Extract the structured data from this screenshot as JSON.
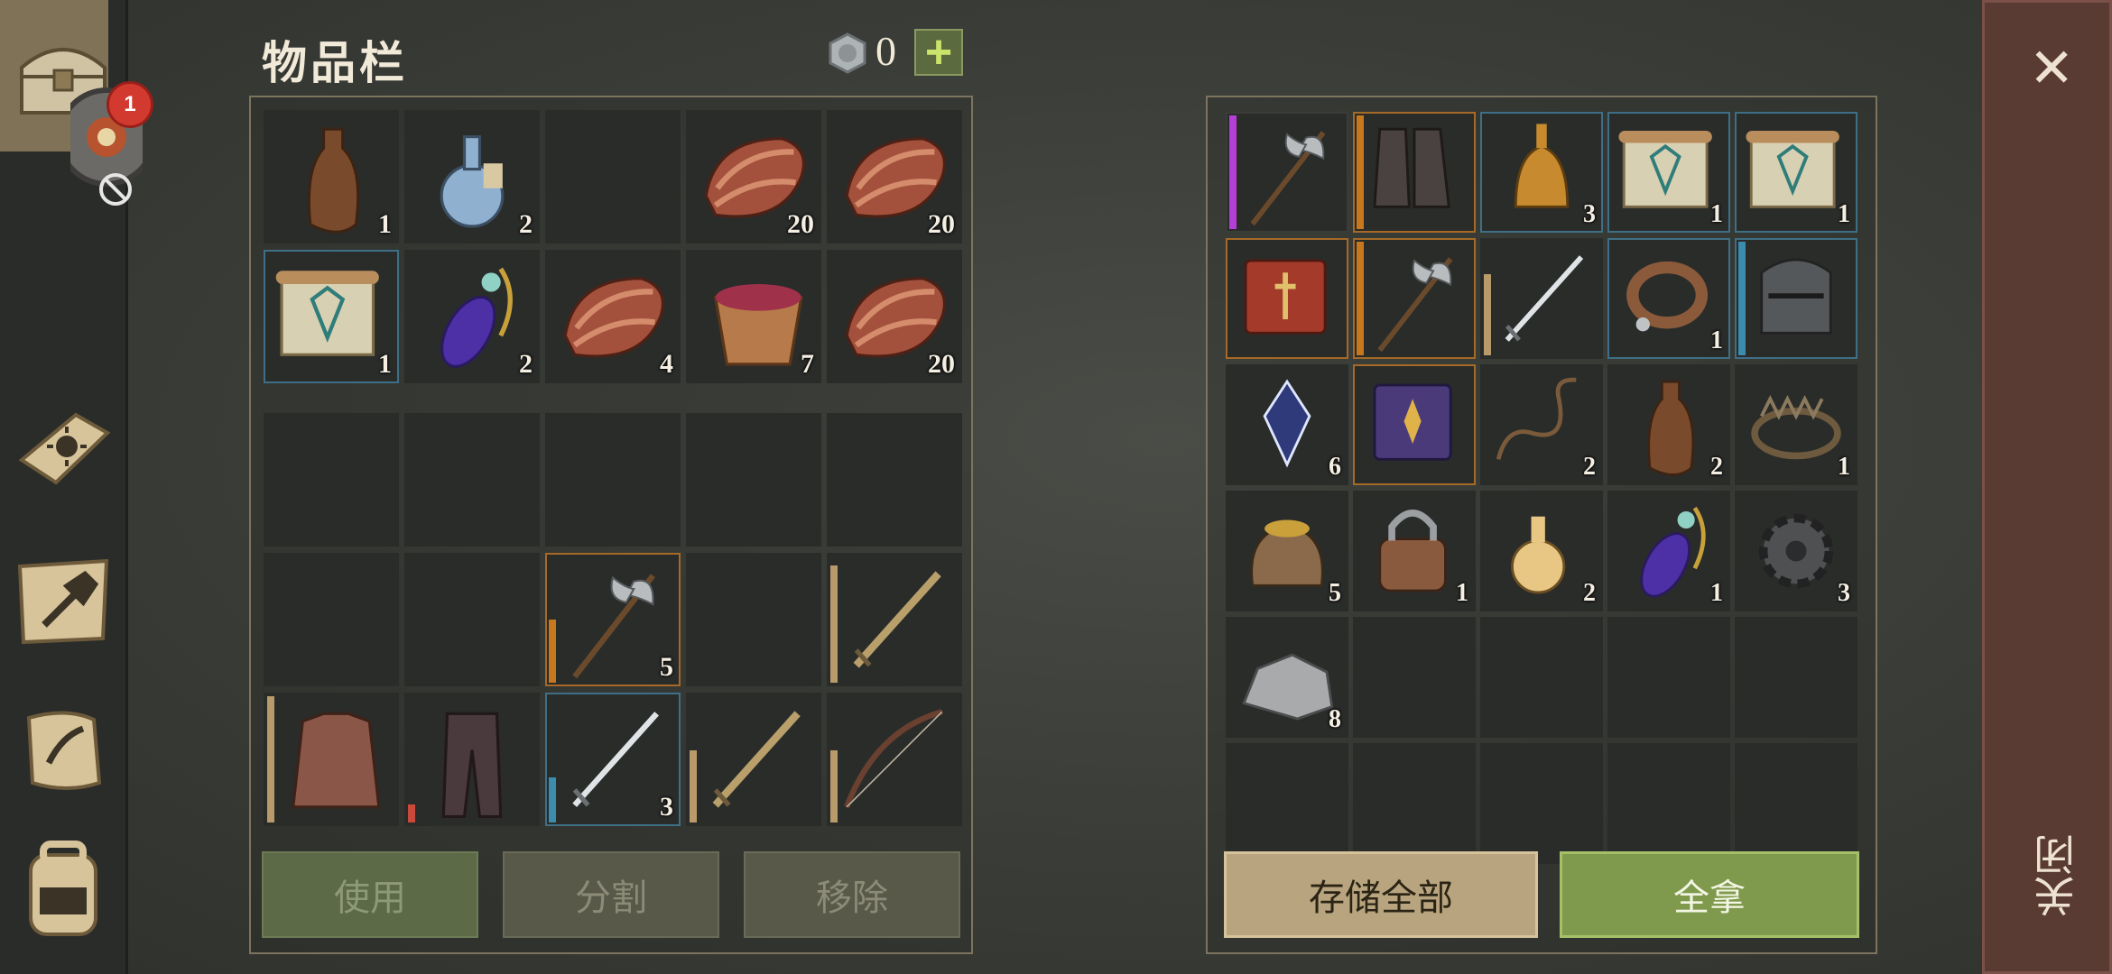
{
  "inventory": {
    "title": "物品栏",
    "coin_count": "0",
    "plus_label": "+",
    "top_counts": [
      "1",
      "2",
      "",
      "20",
      "20",
      "1",
      "2",
      "4",
      "7",
      "20"
    ],
    "bottom_counts": [
      "",
      "",
      "",
      "",
      "",
      "",
      "",
      "5",
      "",
      ""
    ],
    "bottom_row3": [
      "",
      "",
      "3",
      "",
      ""
    ],
    "buttons": {
      "use": "使用",
      "split": "分割",
      "remove": "移除"
    }
  },
  "chest": {
    "counts": [
      "",
      "",
      "3",
      "1",
      "1",
      "",
      "",
      "",
      "1",
      "",
      "6",
      "",
      "2",
      "2",
      "1",
      "5",
      "1",
      "2",
      "1",
      "3",
      "8"
    ],
    "buttons": {
      "store_all": "存储全部",
      "take_all": "全拿"
    }
  },
  "sidebar": {
    "badge": "1"
  },
  "close": {
    "label": "关闭",
    "x": "✕"
  },
  "colors": {
    "accent_green": "#7f9a4c",
    "accent_tan": "#b8a57f",
    "close_bg": "#5a3b34"
  }
}
